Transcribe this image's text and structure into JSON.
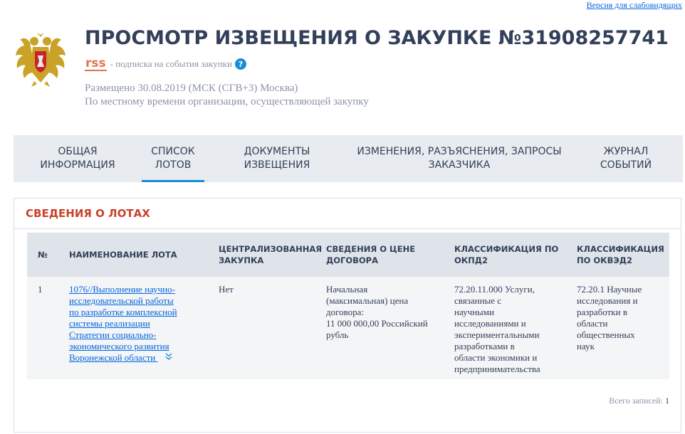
{
  "header": {
    "accessibility_link": "Версия для слабовидящих",
    "title": "ПРОСМОТР ИЗВЕЩЕНИЯ О ЗАКУПКЕ №31908257741",
    "rss_label": "rss",
    "rss_text": "- подписка на события закупки",
    "help_glyph": "?",
    "published_line": "Размещено 30.08.2019 (МСК (СГВ+3) Москва)",
    "timezone_note": "По местному времени организации, осуществляющей закупку"
  },
  "tabs": [
    {
      "line1": "ОБЩАЯ",
      "line2": "ИНФОРМАЦИЯ",
      "active": false
    },
    {
      "line1": "СПИСОК",
      "line2": "ЛОТОВ",
      "active": true
    },
    {
      "line1": "ДОКУМЕНТЫ",
      "line2": "ИЗВЕЩЕНИЯ",
      "active": false
    },
    {
      "line1": "ИЗМЕНЕНИЯ, РАЗЪЯСНЕНИЯ, ЗАПРОСЫ",
      "line2": "ЗАКАЗЧИКА",
      "active": false
    },
    {
      "line1": "ЖУРНАЛ",
      "line2": "СОБЫТИЙ",
      "active": false
    }
  ],
  "panel": {
    "title": "СВЕДЕНИЯ О ЛОТАХ",
    "columns": {
      "num": "№",
      "name": "НАИМЕНОВАНИЕ ЛОТА",
      "central_l1": "ЦЕНТРАЛИЗОВАННАЯ",
      "central_l2": "ЗАКУПКА",
      "price_l1": "СВЕДЕНИЯ О ЦЕНЕ",
      "price_l2": "ДОГОВОРА",
      "okpd_l1": "КЛАССИФИКАЦИЯ ПО",
      "okpd_l2": "ОКПД2",
      "okved_l1": "КЛАССИФИКАЦИЯ",
      "okved_l2": "ПО ОКВЭД2"
    },
    "rows": [
      {
        "num": "1",
        "name_lines": [
          "1076//Выполнение научно-",
          "исследовательской работы",
          "по разработке комплексной",
          "системы реализации",
          "Стратегии социально-",
          "экономического развития",
          "Воронежской области"
        ],
        "central": "Нет",
        "price_lines": [
          "Начальная",
          "(максимальная) цена",
          "договора:",
          "11 000 000,00 Российский",
          "рубль"
        ],
        "okpd_lines": [
          "72.20.11.000 Услуги,",
          "связанные с",
          "научными",
          "исследованиями и",
          "экспериментальными",
          "разработками в",
          "области экономики и",
          "предпринимательства"
        ],
        "okved_lines": [
          "72.20.1 Научные",
          "исследования и",
          "разработки в",
          "области",
          "общественных",
          "наук"
        ]
      }
    ],
    "total_label": "Всего записей:",
    "total_value": "1"
  },
  "colors": {
    "accent": "#1a8bd6",
    "title_red": "#c9422b",
    "rss": "#e2734a",
    "text": "#334059"
  }
}
